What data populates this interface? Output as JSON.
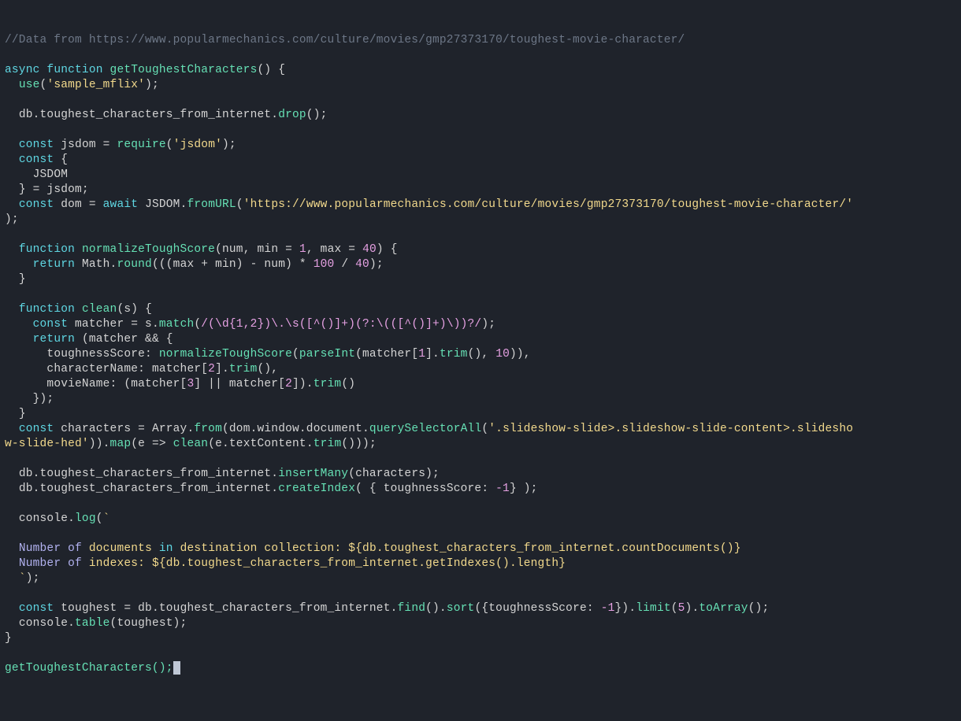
{
  "comment": "//Data from https://www.popularmechanics.com/culture/movies/gmp27373170/toughest-movie-character/",
  "dbUse": "sample_mflix",
  "collection": "toughest_characters_from_internet",
  "requireArg": "jsdom",
  "jsdomConst": "JSDOM",
  "url": "https://www.popularmechanics.com/culture/movies/gmp27373170/toughest-movie-character/",
  "normalize": {
    "name": "normalizeToughScore",
    "arg": "num",
    "minArg": "min",
    "minDef": "1",
    "maxArg": "max",
    "maxDef": "40",
    "div": "100",
    "div2": "40"
  },
  "clean": {
    "name": "clean",
    "arg": "s",
    "regex": "/(\\d{1,2})\\.\\s([^()]+)(?:\\(([^()]+)\\))?/",
    "props": {
      "tscore": "toughnessScore",
      "cname": "characterName",
      "mname": "movieName"
    },
    "idx1": "1",
    "idx2": "2",
    "idx3": "3",
    "radix": "10"
  },
  "selector": ".slideshow-slide>.slideshow-slide-content>.slideshow-slide-hed",
  "indexField": "toughnessScore",
  "indexDir": "-1",
  "logLines": {
    "l1a": "Number",
    "l1b": "of",
    "l1c": "documents",
    "l1d": "in",
    "l1e": "destination collection: ${db.toughest_characters_from_internet.countDocuments()}",
    "l2a": "Number",
    "l2b": "of",
    "l2c": "indexes: ${db.toughest_characters_from_internet.getIndexes().length}"
  },
  "limit": "5",
  "mainFn": "getToughestCharacters",
  "kw": {
    "async": "async",
    "function": "function",
    "const": "const",
    "await": "await",
    "return": "return",
    "Array": "Array",
    "Math": "Math",
    "parseInt": "parseInt",
    "require": "require",
    "use": "use"
  },
  "call": "getToughestCharacters();"
}
